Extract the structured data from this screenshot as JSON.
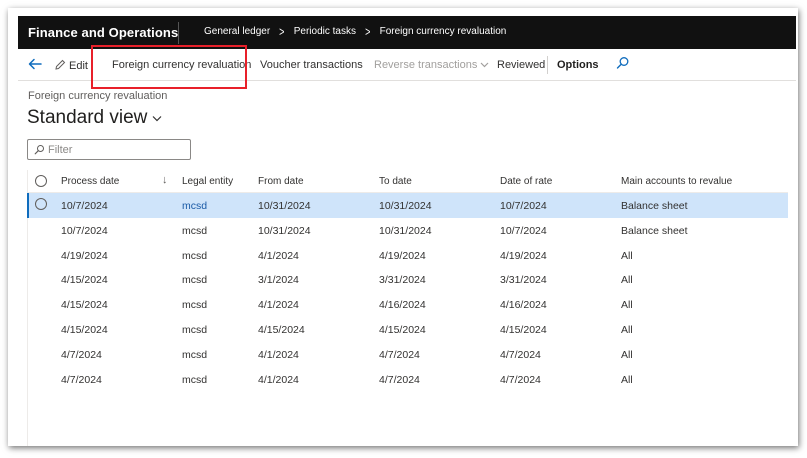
{
  "app": {
    "title": "Finance and Operations"
  },
  "breadcrumb": [
    "General ledger",
    "Periodic tasks",
    "Foreign currency revaluation"
  ],
  "actions": {
    "edit": "Edit",
    "foreign_currency_revaluation": "Foreign currency revaluation",
    "voucher_transactions": "Voucher transactions",
    "reverse_transactions": "Reverse transactions",
    "reviewed": "Reviewed",
    "options": "Options"
  },
  "page": {
    "caption": "Foreign currency revaluation",
    "view_title": "Standard view"
  },
  "filter": {
    "placeholder": "Filter"
  },
  "grid": {
    "columns": [
      "Process date",
      "Legal entity",
      "From date",
      "To date",
      "Date of rate",
      "Main accounts to revalue"
    ],
    "rows": [
      [
        "10/7/2024",
        "mcsd",
        "10/31/2024",
        "10/31/2024",
        "10/7/2024",
        "Balance sheet"
      ],
      [
        "10/7/2024",
        "mcsd",
        "10/31/2024",
        "10/31/2024",
        "10/7/2024",
        "Balance sheet"
      ],
      [
        "4/19/2024",
        "mcsd",
        "4/1/2024",
        "4/19/2024",
        "4/19/2024",
        "All"
      ],
      [
        "4/15/2024",
        "mcsd",
        "3/1/2024",
        "3/31/2024",
        "3/31/2024",
        "All"
      ],
      [
        "4/15/2024",
        "mcsd",
        "4/1/2024",
        "4/16/2024",
        "4/16/2024",
        "All"
      ],
      [
        "4/15/2024",
        "mcsd",
        "4/15/2024",
        "4/15/2024",
        "4/15/2024",
        "All"
      ],
      [
        "4/7/2024",
        "mcsd",
        "4/1/2024",
        "4/7/2024",
        "4/7/2024",
        "All"
      ],
      [
        "4/7/2024",
        "mcsd",
        "4/1/2024",
        "4/7/2024",
        "4/7/2024",
        "All"
      ]
    ],
    "selected_row": 0
  },
  "colors": {
    "topbar": "#111111",
    "selection": "#cfe4fa",
    "link": "#1a5aa6",
    "highlight": "#e8202a"
  },
  "icons": [
    "back-arrow-icon",
    "pencil-icon",
    "chevron-down-icon",
    "search-icon",
    "filter-search-icon",
    "sort-arrow-icon",
    "radio-icon"
  ]
}
